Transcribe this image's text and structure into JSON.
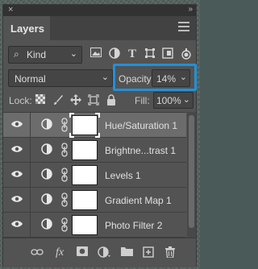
{
  "panel": {
    "title": "Layers",
    "close_glyph": "×",
    "collapse_glyph": "»",
    "menu_icon": "hamburger-menu-icon"
  },
  "filter": {
    "kind_value": "Kind",
    "icons": [
      "image-filter-icon",
      "adjustment-filter-icon",
      "type-filter-icon",
      "shape-filter-icon",
      "smart-object-filter-icon",
      "filter-toggle-icon"
    ]
  },
  "blend": {
    "mode": "Normal",
    "opacity_label": "Opacity:",
    "opacity_value": "14%",
    "highlight_color": "#2390d6"
  },
  "lock": {
    "label": "Lock:",
    "fill_label": "Fill:",
    "fill_value": "100%"
  },
  "layers": [
    {
      "name": "Hue/Saturation 1",
      "selected": true
    },
    {
      "name": "Brightne...trast 1",
      "selected": false
    },
    {
      "name": "Levels 1",
      "selected": false
    },
    {
      "name": "Gradient Map 1",
      "selected": false
    },
    {
      "name": "Photo Filter 2",
      "selected": false
    }
  ],
  "bottom": {
    "icons": [
      "link-layers-icon",
      "fx-icon",
      "add-mask-icon",
      "new-adjustment-icon",
      "new-group-icon",
      "new-layer-icon",
      "delete-layer-icon"
    ],
    "fx_label": "fx"
  }
}
